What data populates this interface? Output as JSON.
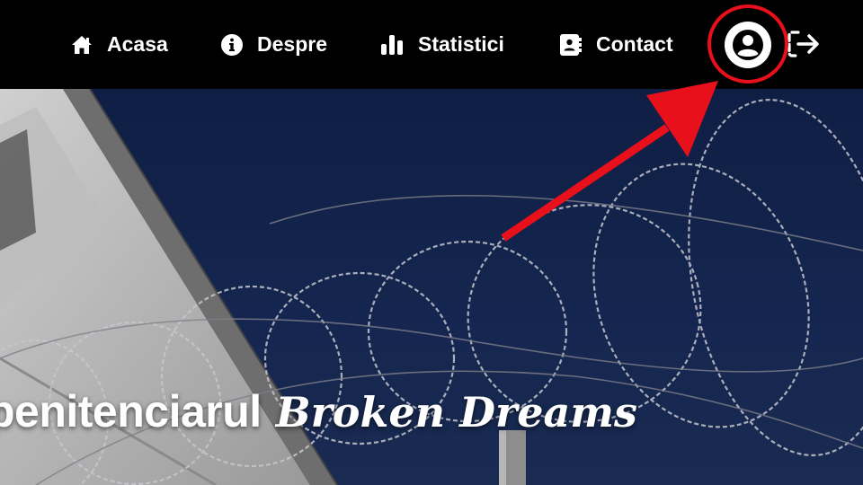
{
  "nav": {
    "items": [
      {
        "label": "Acasa",
        "icon": "home-icon"
      },
      {
        "label": "Despre",
        "icon": "info-circle-icon"
      },
      {
        "label": "Statistici",
        "icon": "bar-chart-icon"
      },
      {
        "label": "Contact",
        "icon": "address-book-icon"
      }
    ],
    "profile_icon": "user-circle-icon",
    "logout_icon": "sign-out-icon"
  },
  "hero": {
    "title_plain": "penitenciarul",
    "title_fancy": "Broken Dreams"
  },
  "annotation": {
    "color": "#e8101a",
    "target": "profile-button"
  },
  "colors": {
    "navbar_bg": "#000000",
    "nav_text": "#ffffff",
    "hero_sky": "#0f1e44"
  }
}
